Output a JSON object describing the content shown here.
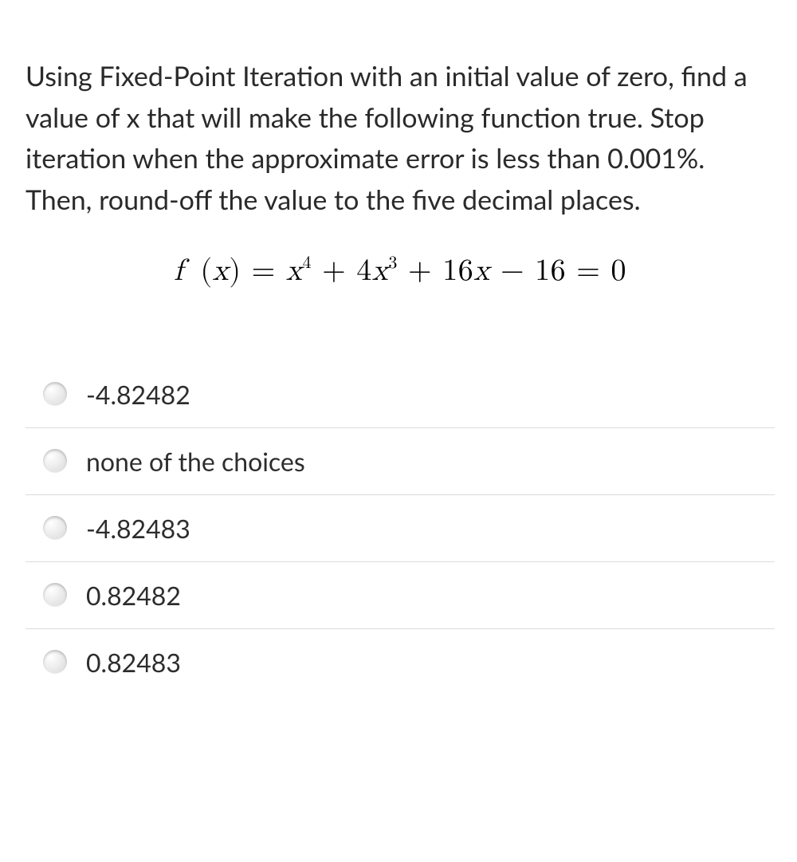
{
  "question": {
    "text": "Using Fixed-Point Iteration with an initial value of zero, find a value of x that will make the following function true. Stop iteration when the approximate error is less than 0.001%. Then, round-off the value to the five decimal places."
  },
  "equation": {
    "lhs_fn": "f",
    "lhs_var": "x",
    "terms": {
      "t1_var": "x",
      "t1_exp": "4",
      "t2_coef": "4",
      "t2_var": "x",
      "t2_exp": "3",
      "t3_coef": "16",
      "t3_var": "x",
      "t4_const": "16",
      "rhs": "0"
    }
  },
  "answers": [
    {
      "label": "-4.82482"
    },
    {
      "label": "none of the choices"
    },
    {
      "label": "-4.82483"
    },
    {
      "label": "0.82482"
    },
    {
      "label": "0.82483"
    }
  ]
}
